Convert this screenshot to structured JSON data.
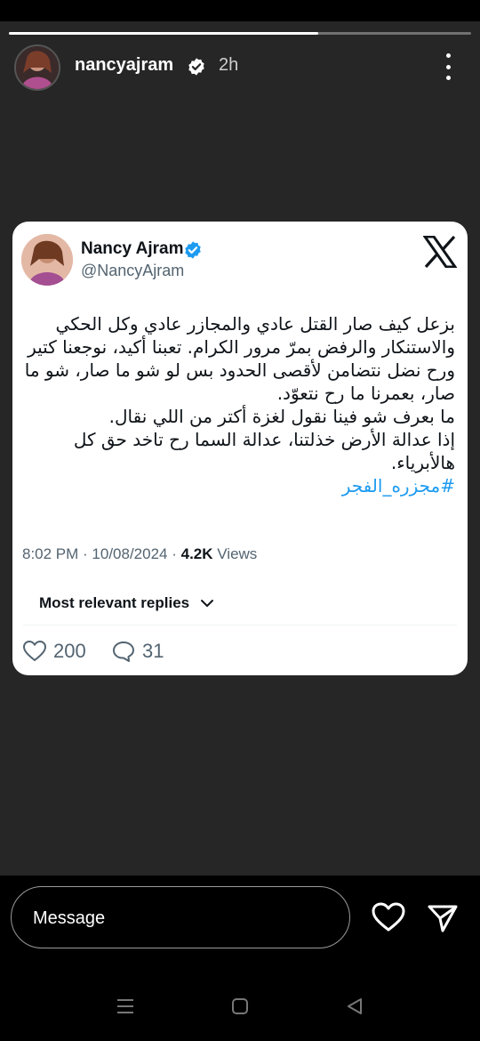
{
  "story": {
    "username": "nancyajram",
    "time": "2h",
    "progress": 0.67
  },
  "tweet": {
    "name": "Nancy Ajram",
    "handle": "@NancyAjram",
    "lines": [
      "بزعل كيف صار القتل عادي والمجازر عادي وكل الحكي والاستنكار والرفض بمرّ مرور الكرام. تعبنا أكيد، نوجعنا كتير ورح نضل نتضامن لأقصى الحدود بس لو شو ما صار، شو ما صار،  بعمرنا ما رح نتعوّد.",
      "ما بعرف شو فينا نقول لغزة أكتر من اللي نقال.",
      "إذا عدالة الأرض خذلتنا، عدالة السما رح تاخد حق كل هالأبرياء."
    ],
    "hashtag": "#مجزره_الفجر",
    "timestamp": "8:02 PM · 10/08/2024 · ",
    "views_count": "4.2K",
    "views_label": " Views",
    "replies_sort": "Most relevant replies",
    "likes": "200",
    "comments": "31"
  },
  "reply_bar": {
    "placeholder": "Message"
  },
  "colors": {
    "accent": "#1d9bf0",
    "story_bg": "#262626",
    "card_bg": "#ffffff"
  }
}
